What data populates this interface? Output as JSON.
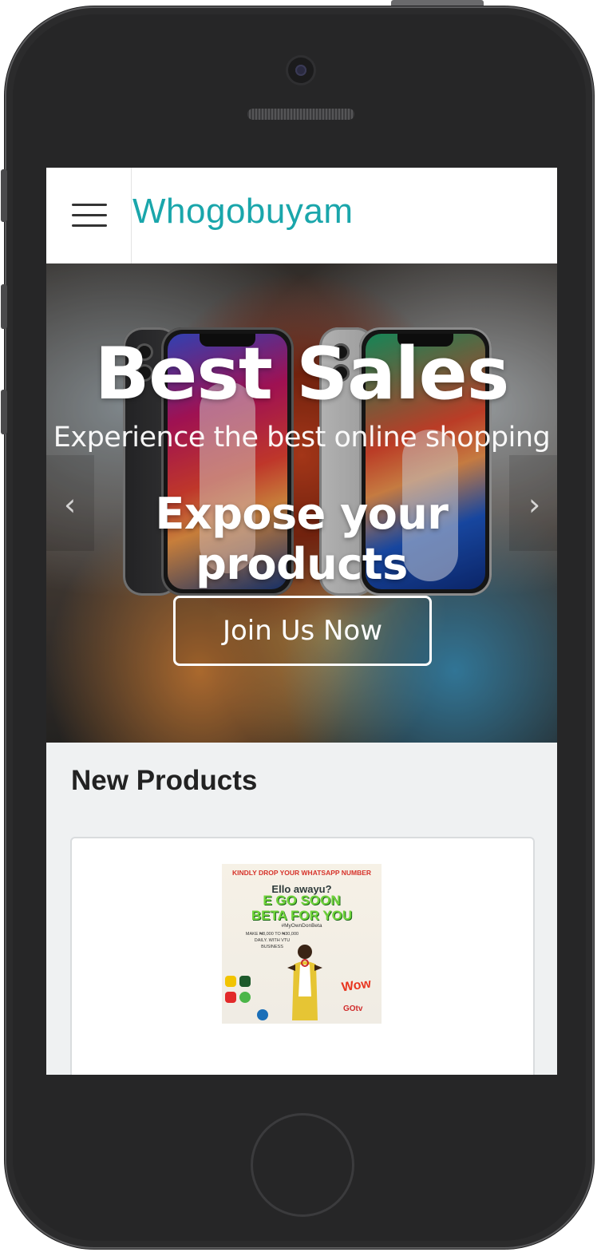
{
  "navbar": {
    "brand": "Whogobuyam",
    "menu_icon": "hamburger-menu-icon"
  },
  "hero": {
    "title": "Best Sales",
    "subtitle": "Experience the best online shopping",
    "tagline": "Expose your products",
    "cta_label": "Join Us Now",
    "next_icon": "chevron-right-icon",
    "prev_icon": "chevron-left-icon"
  },
  "products": {
    "section_title": "New Products",
    "items": [
      {
        "image_text": {
          "top": "KINDLY DROP YOUR WHATSAPP NUMBER",
          "greeting": "Ello awayu?",
          "headline_1": "E GO SOON",
          "headline_2": "BETA FOR YOU",
          "hashtag": "#MyOwnDonBeta",
          "body": "MAKE ₦8,000 TO ₦30,000 DAILY. WITH VTU BUSINESS",
          "brand_a": "Wow",
          "brand_b": "GOtv"
        }
      }
    ]
  },
  "colors": {
    "brand": "#1aa6ab",
    "section_bg": "#eff1f2",
    "device": "#2b2b2c"
  }
}
